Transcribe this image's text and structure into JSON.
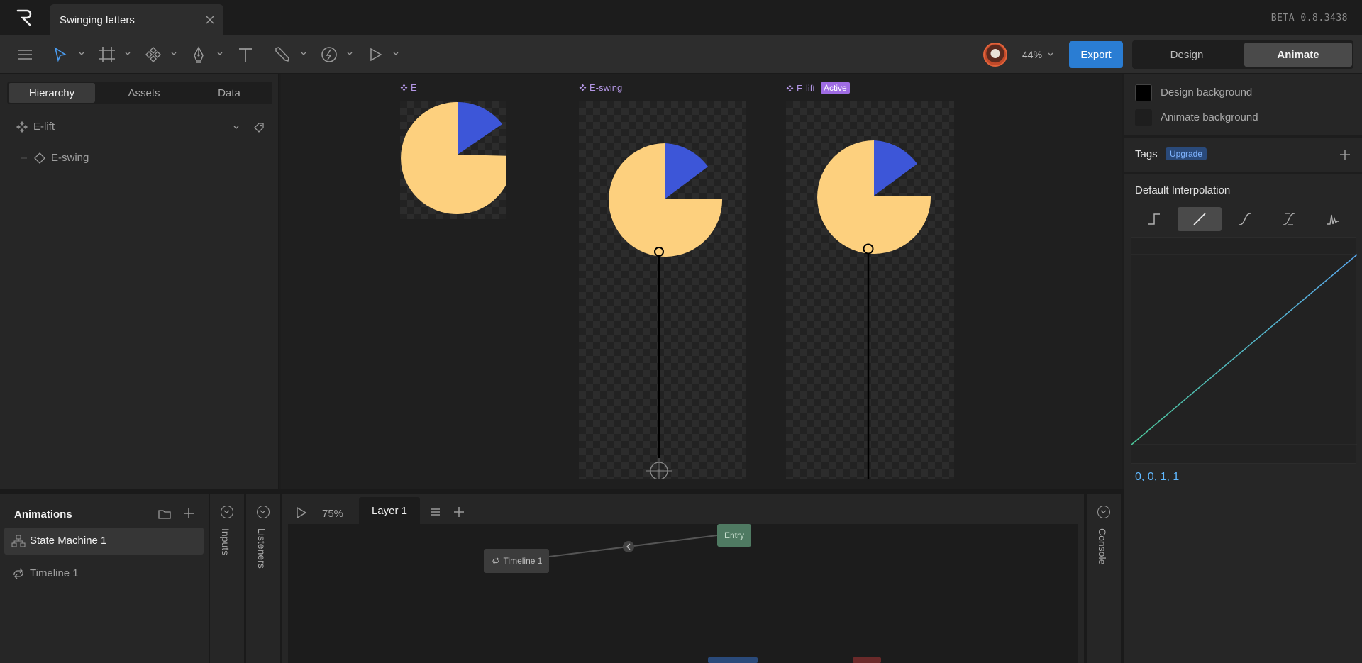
{
  "app": {
    "tab_title": "Swinging letters",
    "version": "BETA 0.8.3438"
  },
  "toolbar": {
    "zoom": "44%",
    "export_label": "Export",
    "mode_design": "Design",
    "mode_animate": "Animate",
    "icons": [
      "menu-icon",
      "select-arrow-icon",
      "frame-icon",
      "component-icon",
      "pen-icon",
      "text-icon",
      "bone-icon",
      "constraint-icon",
      "play-icon"
    ]
  },
  "left_panel": {
    "tabs": [
      "Hierarchy",
      "Assets",
      "Data"
    ],
    "active_tab": "Hierarchy",
    "tree": [
      {
        "label": "E-lift",
        "icon": "component-icon"
      },
      {
        "label": "E-swing",
        "icon": "diamond-icon"
      }
    ]
  },
  "canvas": {
    "artboards": [
      {
        "label": "E",
        "active": false
      },
      {
        "label": "E-swing",
        "active": false
      },
      {
        "label": "E-lift",
        "active": true
      }
    ],
    "active_badge": "Active",
    "colors": {
      "shape_fill": "#fdd07e",
      "accent_fill": "#3d56d8",
      "label": "#b497e6"
    }
  },
  "right_panel": {
    "design_background": "Design background",
    "animate_background": "Animate background",
    "tags_label": "Tags",
    "upgrade_label": "Upgrade",
    "interpolation_title": "Default Interpolation",
    "interpolation_modes": [
      "hold",
      "linear",
      "cubic",
      "cubic-custom",
      "elastic"
    ],
    "interpolation_selected": "linear",
    "curve_values": "0, 0, 1, 1"
  },
  "bottom": {
    "animations_title": "Animations",
    "state_machine_label": "State Machine 1",
    "timeline_label": "Timeline 1",
    "inputs_label": "Inputs",
    "listeners_label": "Listeners",
    "console_label": "Console",
    "sm_zoom": "75%",
    "layer_tab": "Layer 1",
    "nodes": {
      "timeline": "Timeline 1",
      "entry": "Entry"
    }
  }
}
